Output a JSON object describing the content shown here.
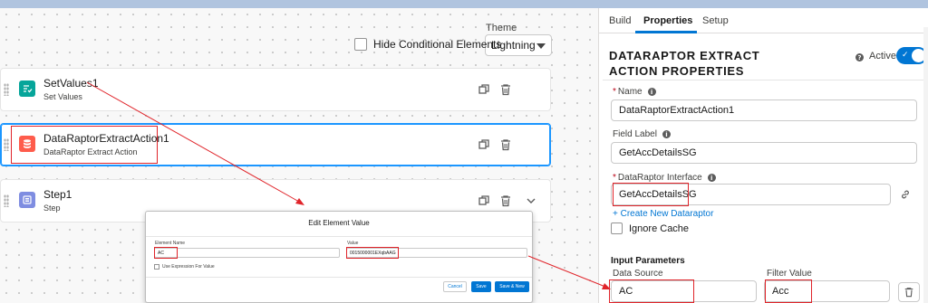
{
  "canvas": {
    "theme_label": "Theme",
    "theme_value": "Lightning",
    "hide_conditional_label": "Hide Conditional Elements",
    "elements": [
      {
        "title": "SetValues1",
        "subtitle": "Set Values",
        "icon": "set-values-icon",
        "color": "#06a59a"
      },
      {
        "title": "DataRaptorExtractAction1",
        "subtitle": "DataRaptor Extract Action",
        "icon": "database-icon",
        "color": "#fe5c4c"
      },
      {
        "title": "Step1",
        "subtitle": "Step",
        "icon": "step-icon",
        "color": "#7f8de1"
      }
    ]
  },
  "modal": {
    "title": "Edit Element Value",
    "element_name_label": "Element Name",
    "element_name_value": "AC",
    "value_label": "Value",
    "value_value": "0015000001EXqbAAG",
    "use_expression_label": "Use Expression For Value",
    "cancel_label": "Cancel",
    "save_label": "Save",
    "save_new_label": "Save & New"
  },
  "panel": {
    "tabs": [
      "Build",
      "Properties",
      "Setup"
    ],
    "active_tab": "Properties",
    "title_line1": "DATARAPTOR EXTRACT",
    "title_line2": "ACTION PROPERTIES",
    "active_label": "Active",
    "active": true,
    "name_label": "Name",
    "name_value": "DataRaptorExtractAction1",
    "field_label_label": "Field Label",
    "field_label_value": "GetAccDetailsSG",
    "interface_label": "DataRaptor Interface",
    "interface_value": "GetAccDetailsSG",
    "create_link": "+ Create New Dataraptor",
    "ignore_cache_label": "Ignore Cache",
    "input_params_heading": "Input Parameters",
    "data_source_label": "Data Source",
    "data_source_value": "AC",
    "filter_value_label": "Filter Value",
    "filter_value_value": "Acc"
  },
  "colors": {
    "brand": "#0176d3",
    "annotation": "#e0242a"
  }
}
